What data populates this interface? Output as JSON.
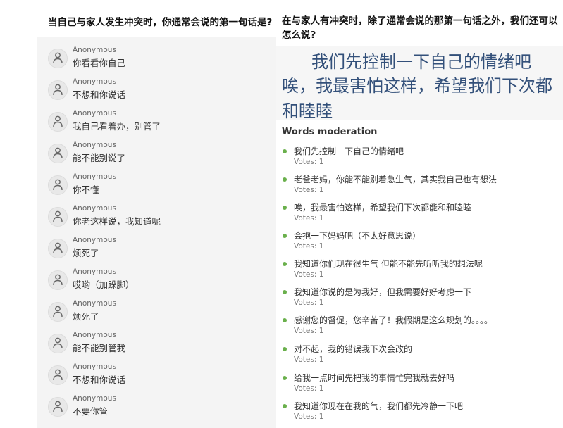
{
  "left_panel": {
    "question": "当自己与家人发生冲突时，你通常会说的第一句话是?",
    "responses": [
      {
        "name": "Anonymous",
        "text": "你看看你自己"
      },
      {
        "name": "Anonymous",
        "text": "不想和你说话"
      },
      {
        "name": "Anonymous",
        "text": "我自己看着办，别管了"
      },
      {
        "name": "Anonymous",
        "text": "能不能别说了"
      },
      {
        "name": "Anonymous",
        "text": "你不懂"
      },
      {
        "name": "Anonymous",
        "text": "你老这样说，我知道呢"
      },
      {
        "name": "Anonymous",
        "text": "烦死了"
      },
      {
        "name": "Anonymous",
        "text": "哎哟（加跺脚）"
      },
      {
        "name": "Anonymous",
        "text": "烦死了"
      },
      {
        "name": "Anonymous",
        "text": "能不能别管我"
      },
      {
        "name": "Anonymous",
        "text": "不想和你说话"
      },
      {
        "name": "Anonymous",
        "text": "不要你管"
      }
    ]
  },
  "right_panel": {
    "question": "在与家人有冲突时，除了通常会说的那第一句话之外，我们还可以怎么说?",
    "word_cloud": {
      "lines": [
        "我们先控制一下自己的情绪吧",
        "唉，我最害怕这样，希望我们下次都",
        "和睦睦"
      ],
      "color": "#33507a"
    },
    "section_label": "Words moderation",
    "items": [
      {
        "text": "我们先控制一下自己的情绪吧",
        "votes": "Votes: 1"
      },
      {
        "text": "老爸老妈，你能不能别着急生气，其实我自己也有想法",
        "votes": "Votes: 1"
      },
      {
        "text": "唉，我最害怕这样，希望我们下次都能和和睦睦",
        "votes": "Votes: 1"
      },
      {
        "text": "会抱一下妈妈吧（不太好意思说）",
        "votes": "Votes: 1"
      },
      {
        "text": "我知道你们现在很生气 但能不能先听听我的想法呢",
        "votes": "Votes: 1"
      },
      {
        "text": "我知道你说的是为我好，但我需要好好考虑一下",
        "votes": "Votes: 1"
      },
      {
        "text": "感谢您的督促，您辛苦了！我假期是这么规划的。。。。",
        "votes": "Votes: 1"
      },
      {
        "text": "对不起，我的错误我下次会改的",
        "votes": "Votes: 1"
      },
      {
        "text": "给我一点时间先把我的事情忙完我就去好吗",
        "votes": "Votes: 1"
      },
      {
        "text": "我知道你现在在我的气，我们都先冷静一下吧",
        "votes": "Votes: 1"
      }
    ],
    "dot_color": "#6ab04c"
  },
  "icons": {
    "avatar": "user-icon",
    "bullet": "bullet-dot-icon"
  }
}
